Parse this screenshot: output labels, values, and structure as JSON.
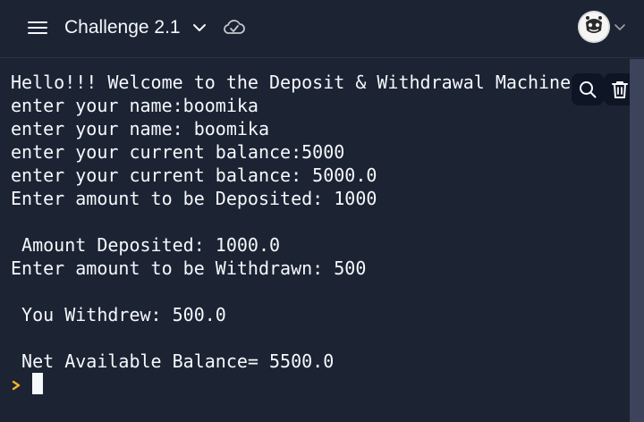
{
  "header": {
    "title": "Challenge 2.1",
    "menu_icon": "hamburger-menu-icon",
    "dropdown_icon": "chevron-down-icon",
    "status_icon": "cloud-check-icon",
    "avatar_icon": "user-avatar",
    "avatar_dropdown_icon": "chevron-down-icon"
  },
  "console": {
    "lines": [
      "Hello!!! Welcome to the Deposit & Withdrawal Machine",
      "enter your name:boomika",
      "enter your name: boomika",
      "enter your current balance:5000",
      "enter your current balance: 5000.0",
      "Enter amount to be Deposited: 1000",
      "",
      " Amount Deposited: 1000.0",
      "Enter amount to be Withdrawn: 500",
      "",
      " You Withdrew: 500.0",
      "",
      " Net Available Balance= 5500.0"
    ],
    "prompt_icon": "prompt-chevron-icon",
    "tools": {
      "search_icon": "search-icon",
      "clear_icon": "trash-icon"
    }
  },
  "colors": {
    "background": "#1c2333",
    "text": "#f5f9fc",
    "prompt": "#f0b429",
    "scrollbar": "#3c445c",
    "tool_button": "#0e1525"
  }
}
